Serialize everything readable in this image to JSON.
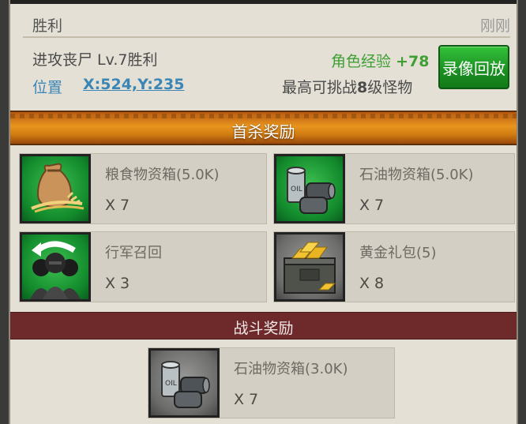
{
  "header": {
    "title": "胜利",
    "time": "刚刚"
  },
  "battle": {
    "attack_text": "进攻丧尸 Lv.7胜利",
    "location_label": "位置",
    "location_coords": "X:524,Y:235",
    "exp_label": "角色经验",
    "exp_value": "+78",
    "max_prefix": "最高可挑战",
    "max_level": "8",
    "max_suffix": "级怪物",
    "replay_button": "录像回放"
  },
  "first_kill": {
    "title": "首杀奖励",
    "items": [
      {
        "name": "粮食物资箱(5.0K)",
        "qty": "X 7",
        "icon": "grain-sack-icon"
      },
      {
        "name": "石油物资箱(5.0K)",
        "qty": "X 7",
        "icon": "oil-barrel-icon"
      },
      {
        "name": "行军召回",
        "qty": "X 3",
        "icon": "march-recall-icon"
      },
      {
        "name": "黄金礼包(5)",
        "qty": "X 8",
        "icon": "gold-crate-icon"
      }
    ]
  },
  "battle_reward": {
    "title": "战斗奖励",
    "items": [
      {
        "name": "石油物资箱(3.0K)",
        "qty": "X 7",
        "icon": "oil-barrel-icon"
      }
    ]
  },
  "colors": {
    "accent_green": "#3f9f35",
    "link_blue": "#3b86b5",
    "band_orange": "#e8951e",
    "band_red": "#6e2a2b"
  }
}
